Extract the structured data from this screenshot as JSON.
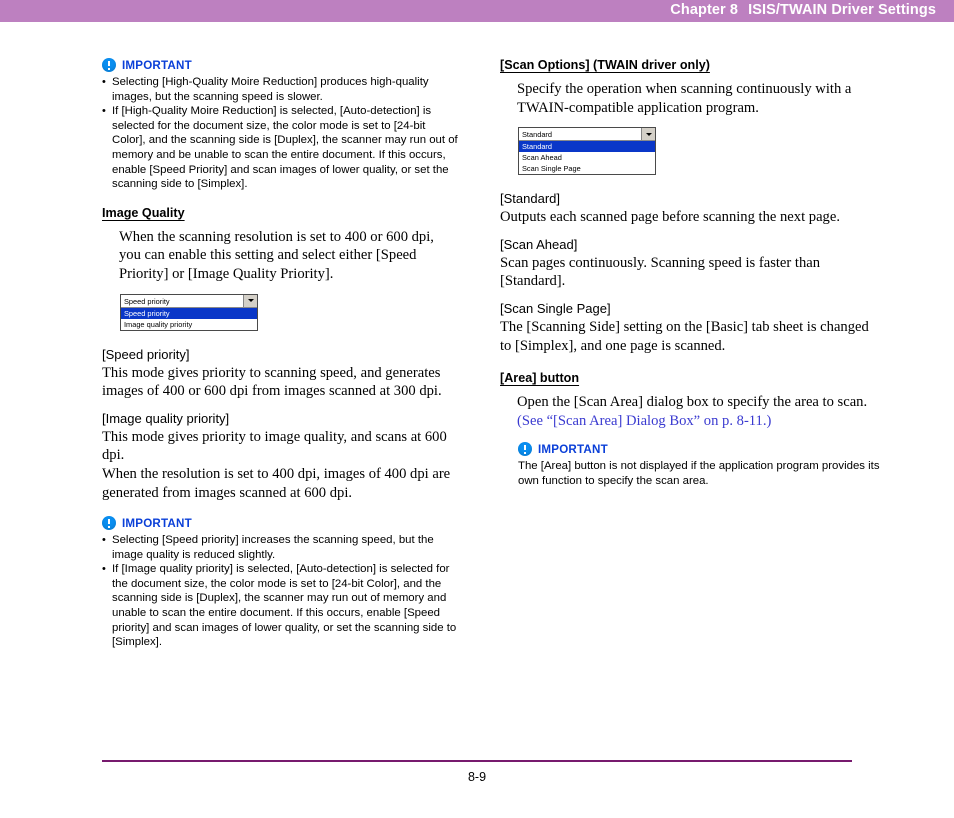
{
  "header": {
    "chapter": "Chapter 8",
    "title": "ISIS/TWAIN Driver Settings"
  },
  "footer": {
    "page_number": "8-9",
    "rule_color": "#771a6e"
  },
  "colors": {
    "header_band": "#bd80c0",
    "important_text": "#0a3fd8",
    "important_icon": "#0a8ef0",
    "crossref_link": "#3a3ad0",
    "combo_highlight": "#0a37c8"
  },
  "left_column": {
    "important_1": {
      "label": "IMPORTANT",
      "icon": "exclamation-circle-icon",
      "bullets": [
        "Selecting [High-Quality Moire Reduction] produces high-quality images, but the scanning speed is slower.",
        "If [High-Quality Moire Reduction] is selected, [Auto-detection] is selected for the document size, the color mode is set to [24-bit Color], and the scanning side is [Duplex], the scanner may run out of memory and be unable to scan the entire document. If this occurs, enable [Speed Priority] and scan images of lower quality, or set the scanning side to [Simplex]."
      ]
    },
    "section": {
      "heading": "Image Quality",
      "intro": "When the scanning resolution is set to 400 or 600 dpi, you can enable this setting and select either [Speed Priority] or [Image Quality Priority].",
      "combo": {
        "value": "Speed priority",
        "options": [
          "Speed priority",
          "Image quality priority"
        ],
        "selected_index": 0
      },
      "entries": [
        {
          "label": "[Speed priority]",
          "paragraphs": [
            "This mode gives priority to scanning speed, and generates images of 400 or 600 dpi from images scanned at 300 dpi."
          ]
        },
        {
          "label": "[Image quality priority]",
          "paragraphs": [
            "This mode gives priority to image quality, and scans at 600 dpi.",
            "When the resolution is set to 400 dpi, images of 400 dpi are generated from images scanned at 600 dpi."
          ]
        }
      ]
    },
    "important_2": {
      "label": "IMPORTANT",
      "icon": "exclamation-circle-icon",
      "bullets": [
        "Selecting [Speed priority] increases the scanning speed, but the image quality is reduced slightly.",
        "If [Image quality priority] is selected, [Auto-detection] is selected for the document size, the color mode is set to [24-bit Color], and the scanning side is [Duplex], the scanner may run out of memory and unable to scan the entire document. If this occurs, enable [Speed priority] and scan images of lower quality, or set the scanning side to [Simplex]."
      ]
    }
  },
  "right_column": {
    "scan_options": {
      "heading": "[Scan Options] (TWAIN driver only)",
      "intro": "Specify the operation when scanning continuously with a TWAIN-compatible application program.",
      "combo": {
        "value": "Standard",
        "options": [
          "Standard",
          "Scan Ahead",
          "Scan Single Page"
        ],
        "selected_index": 0
      },
      "entries": [
        {
          "label": "[Standard]",
          "paragraphs": [
            "Outputs each scanned page before scanning the next page."
          ]
        },
        {
          "label": "[Scan Ahead]",
          "paragraphs": [
            "Scan pages continuously. Scanning speed is faster than [Standard]."
          ]
        },
        {
          "label": "[Scan Single Page]",
          "paragraphs": [
            "The [Scanning Side] setting on the [Basic] tab sheet is changed to [Simplex], and one page is scanned."
          ]
        }
      ]
    },
    "area_button": {
      "heading": "[Area] button",
      "body_prefix": "Open the [Scan Area] dialog box to specify the area to scan. ",
      "crossref": "(See “[Scan Area] Dialog Box” on p. 8-11.)",
      "important": {
        "label": "IMPORTANT",
        "icon": "exclamation-circle-icon",
        "text": "The [Area] button is not displayed if the application program provides its own function to specify the scan area."
      }
    }
  }
}
